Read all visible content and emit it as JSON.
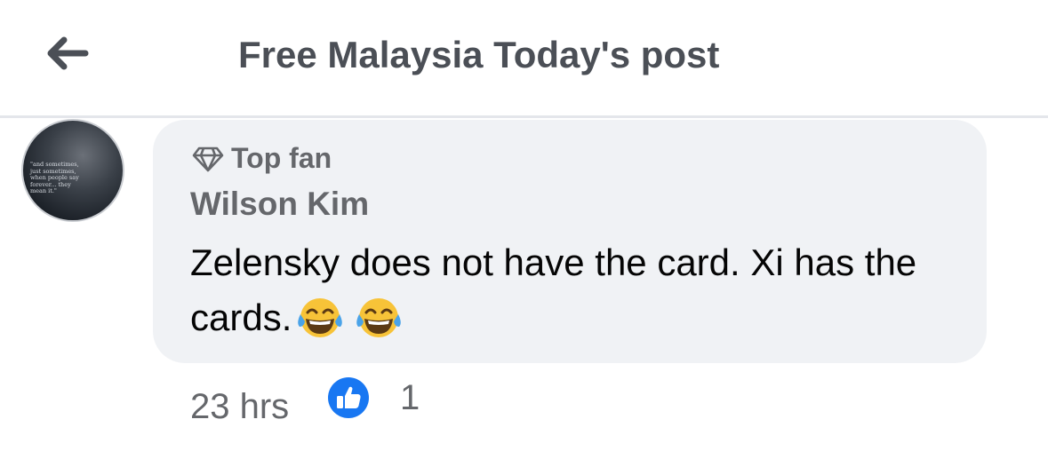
{
  "header": {
    "title": "Free Malaysia Today's post"
  },
  "avatar": {
    "quote": "\"and sometimes, just sometimes, when people say forever... they mean it.\""
  },
  "comment": {
    "badge": "Top fan",
    "author": "Wilson Kim",
    "text": "Zelensky does not have the card.  Xi has the cards.",
    "emojis": [
      "face-with-tears-of-joy",
      "face-with-tears-of-joy"
    ]
  },
  "footer": {
    "time": "23 hrs",
    "like_count": "1"
  },
  "colors": {
    "like_blue": "#1877f2",
    "bubble_bg": "#f0f2f5",
    "muted_text": "#65676b"
  }
}
